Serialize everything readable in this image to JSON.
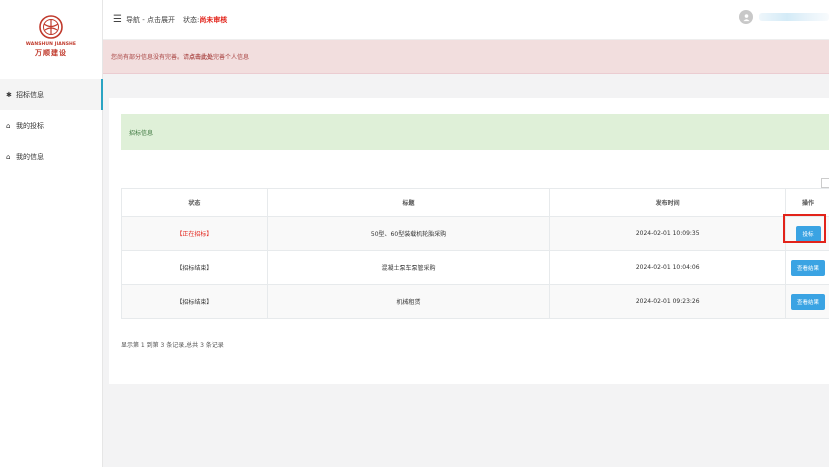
{
  "sidebar": {
    "logo_en": "WANSHUN JIANSHE",
    "logo_cn": "万顺建设",
    "items": [
      {
        "label": "招标信息",
        "icon": "gear-icon"
      },
      {
        "label": "我的投标",
        "icon": "home-icon"
      },
      {
        "label": "我的信息",
        "icon": "home-icon"
      }
    ]
  },
  "header": {
    "nav_text": "导航 - 点击展开",
    "status_label": "状态:",
    "status_value": "尚未审核"
  },
  "alert": {
    "prefix": "您尚有部分信息没有完善。请",
    "link": "点击此处",
    "suffix": "完善个人信息"
  },
  "main": {
    "section_title": "招标信息",
    "table": {
      "headers": [
        "状态",
        "标题",
        "发布时间",
        "操作"
      ],
      "rows": [
        {
          "status": "【正在招标】",
          "title": "50型、60型装载机轮胎采购",
          "time": "2024-02-01 10:09:35",
          "action": "投标"
        },
        {
          "status": "【招标结束】",
          "title": "混凝土泵车泵管采购",
          "time": "2024-02-01 10:04:06",
          "action": "查看结果"
        },
        {
          "status": "【招标结束】",
          "title": "机械租赁",
          "time": "2024-02-01 09:23:26",
          "action": "查看结果"
        }
      ]
    },
    "summary": "显示第 1 到第 3 条记录,总共 3 条记录"
  },
  "colors": {
    "accent": "#3aa3e3",
    "danger": "#e2231a",
    "alert_bg": "#f2dede",
    "success_bg": "#dff0d8"
  }
}
